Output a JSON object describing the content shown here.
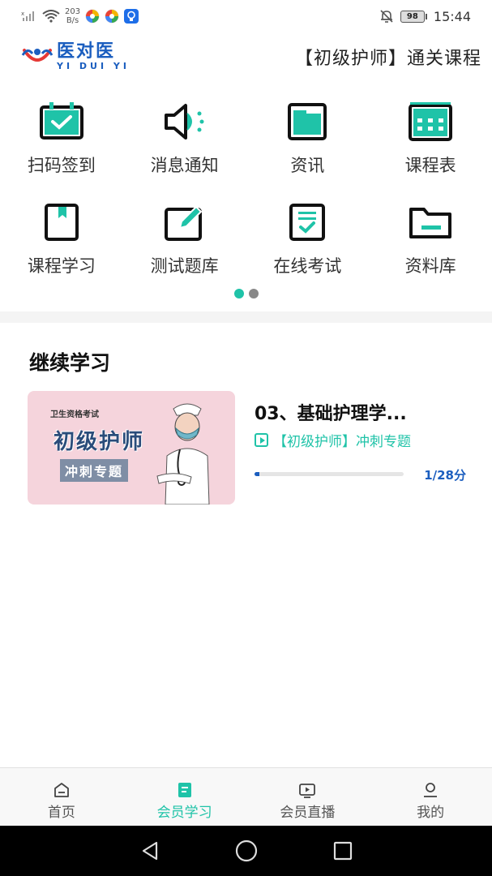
{
  "status_bar": {
    "net_speed_value": "203",
    "net_speed_unit": "B/s",
    "battery": "98",
    "time": "15:44"
  },
  "header": {
    "logo_cn": "医对医",
    "logo_en": "YI DUI YI",
    "title": "【初级护师】通关课程"
  },
  "menu": [
    {
      "label": "扫码签到",
      "icon": "calendar-check-icon"
    },
    {
      "label": "消息通知",
      "icon": "speaker-icon"
    },
    {
      "label": "资讯",
      "icon": "news-window-icon"
    },
    {
      "label": "课程表",
      "icon": "schedule-grid-icon"
    },
    {
      "label": "课程学习",
      "icon": "bookmark-book-icon"
    },
    {
      "label": "测试题库",
      "icon": "edit-pencil-icon"
    },
    {
      "label": "在线考试",
      "icon": "exam-paper-icon"
    },
    {
      "label": "资料库",
      "icon": "folder-icon"
    }
  ],
  "pager": {
    "total": 2,
    "active": 0
  },
  "continue": {
    "section_title": "继续学习",
    "course": {
      "thumb_small": "卫生资格考试",
      "thumb_big": "初级护师",
      "thumb_tag": "冲刺专题",
      "name": "03、基础护理学...",
      "subtitle": "【初级护师】冲刺专题",
      "progress_text": "1/28分",
      "progress_fraction": 0.03
    }
  },
  "bottom_nav": [
    {
      "label": "首页",
      "active": false
    },
    {
      "label": "会员学习",
      "active": true
    },
    {
      "label": "会员直播",
      "active": false
    },
    {
      "label": "我的",
      "active": false
    }
  ],
  "colors": {
    "accent": "#1fc3a8",
    "brand_blue": "#1b5ebf",
    "icon_dark": "#111111"
  }
}
